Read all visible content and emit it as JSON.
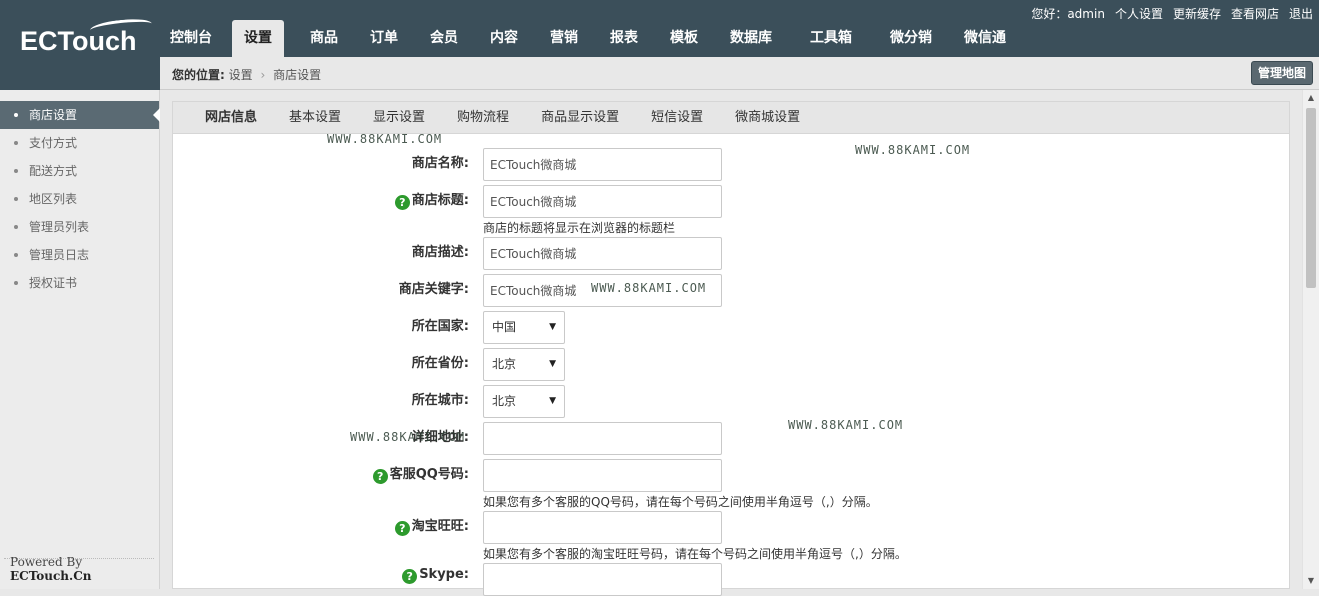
{
  "logo": "ECTouch",
  "top_links": [
    "您好：admin",
    "个人设置",
    "更新缓存",
    "查看网店",
    "退出"
  ],
  "nav": [
    {
      "label": "控制台",
      "active": false
    },
    {
      "label": "设置",
      "active": true
    },
    {
      "label": "商品",
      "active": false
    },
    {
      "label": "订单",
      "active": false
    },
    {
      "label": "会员",
      "active": false
    },
    {
      "label": "内容",
      "active": false
    },
    {
      "label": "营销",
      "active": false
    },
    {
      "label": "报表",
      "active": false
    },
    {
      "label": "模板",
      "active": false
    },
    {
      "label": "数据库",
      "active": false
    },
    {
      "label": "工具箱",
      "active": false
    },
    {
      "label": "微分销",
      "active": false
    },
    {
      "label": "微信通",
      "active": false
    }
  ],
  "breadcrumb": {
    "prefix": "您的位置:",
    "items": [
      "设置",
      "商店设置"
    ],
    "separator": "›"
  },
  "sitemap_button": "管理地图",
  "sidebar": {
    "items": [
      "商店设置",
      "支付方式",
      "配送方式",
      "地区列表",
      "管理员列表",
      "管理员日志",
      "授权证书"
    ],
    "active": "商店设置",
    "powered_prefix": "Powered By ",
    "powered_brand": "ECTouch.Cn"
  },
  "tabs": [
    "网店信息",
    "基本设置",
    "显示设置",
    "购物流程",
    "商品显示设置",
    "短信设置",
    "微商城设置"
  ],
  "active_tab": "网店信息",
  "form": {
    "shop_name": {
      "label": "商店名称:",
      "value": "ECTouch微商城"
    },
    "shop_title": {
      "label": "商店标题:",
      "value": "ECTouch微商城",
      "hint": "商店的标题将显示在浏览器的标题栏"
    },
    "shop_desc": {
      "label": "商店描述:",
      "value": "ECTouch微商城"
    },
    "shop_keywords": {
      "label": "商店关键字:",
      "value": "ECTouch微商城"
    },
    "country": {
      "label": "所在国家:",
      "value": "中国"
    },
    "province": {
      "label": "所在省份:",
      "value": "北京"
    },
    "city": {
      "label": "所在城市:",
      "value": "北京"
    },
    "address": {
      "label": "详细地址:",
      "value": ""
    },
    "qq": {
      "label": "客服QQ号码:",
      "value": "",
      "hint": "如果您有多个客服的QQ号码，请在每个号码之间使用半角逗号（,）分隔。"
    },
    "wangwang": {
      "label": "淘宝旺旺:",
      "value": "",
      "hint": "如果您有多个客服的淘宝旺旺号码，请在每个号码之间使用半角逗号（,）分隔。"
    },
    "skype": {
      "label": "Skype:",
      "value": ""
    }
  },
  "watermark": "WWW.88KAMI.COM",
  "colors": {
    "header_bg": "#3b4f5a",
    "help_icon": "#2d9a2d",
    "sidebar_active": "#5a6a73"
  }
}
